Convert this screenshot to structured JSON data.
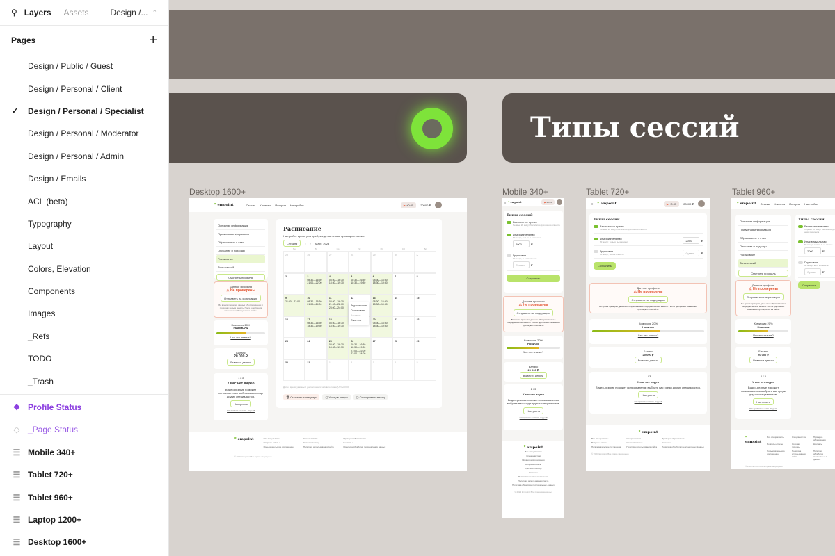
{
  "panel": {
    "tabs": {
      "layers": "Layers",
      "assets": "Assets",
      "page_selector": "Design /..."
    },
    "pages_title": "Pages",
    "pages": [
      "Design / Public / Guest",
      "Design / Personal / Client",
      "Design / Personal / Specialist",
      "Design / Personal / Moderator",
      "Design / Personal / Admin",
      "Design / Emails",
      "ACL (beta)",
      "Typography",
      "Layout",
      "Colors, Elevation",
      "Components",
      "Images",
      "_Refs",
      "TODO",
      "_Trash"
    ],
    "selected_page": "Design / Personal / Specialist",
    "layers": [
      {
        "label": "Profile Status",
        "type": "component"
      },
      {
        "label": "_Page Status",
        "type": "instance"
      },
      {
        "label": "Mobile 340+",
        "type": "frame"
      },
      {
        "label": "Tablet 720+",
        "type": "frame"
      },
      {
        "label": "Tablet 960+",
        "type": "frame"
      },
      {
        "label": "Laptop 1200+",
        "type": "frame"
      },
      {
        "label": "Desktop 1600+",
        "type": "frame"
      }
    ]
  },
  "canvas": {
    "cover_title": "Типы сессий",
    "accent": "#7ee33a",
    "frames": {
      "desktop": "Desktop 1600+",
      "mobile": "Mobile 340+",
      "tablet720": "Tablet 720+",
      "tablet960": "Tablet 960+"
    }
  },
  "site": {
    "logo": "empoint",
    "nav": [
      "Сессии",
      "Клиенты",
      "Истории",
      "Настройки"
    ],
    "timer": "+0:05",
    "balance_short": "20000 ₽",
    "menu": [
      "Основная информация",
      "Приватная информация",
      "Образование и стаж",
      "Описание и подходы",
      "Расписание",
      "Типы сессий"
    ],
    "view_profile": "Смотреть профиль",
    "profile_label": "Данные профиля",
    "profile_status": "Не проверены",
    "send_moderation": "Отправить на модерацию",
    "moderation_note": "Во время проверки данных об образовании и подходах нельзя менять. После одобрения изменения публикуются на сайте.",
    "commission": "Комиссия 20%",
    "level": "Новичок",
    "level_progress": 0.6,
    "what_means": "Что это значит?",
    "balance_label": "Баланс",
    "balance": "20 000 ₽",
    "withdraw": "Вывести деньги",
    "video_pager": "1 / 3",
    "no_video": "У вас нет видео",
    "video_text": "Видео-резюме поможет пользователям выбрать вас среди других специалистов.",
    "setup": "Настроить",
    "how_record": "Как правильно снять видео?",
    "footer_links": [
      "Все специалисты",
      "Специалистам",
      "Проверка образования",
      "Вопросы-ответы",
      "Срочная помощь",
      "Контакты",
      "Пользовательское соглашение",
      "Политика использования сайта",
      "Политика обработки персональных данных"
    ],
    "copyright": "© 2023 Empoint. Все права защищены."
  },
  "schedule": {
    "title": "Расписание",
    "subtitle": "Настройте время для дней, когда вы готовы проводить сессии.",
    "today": "Сегодня",
    "month": "Март, 2023",
    "weekdays": [
      "Пн",
      "Вт",
      "Ср",
      "Чт",
      "Пт",
      "Сб",
      "Вс"
    ],
    "cells": [
      [
        "25",
        [],
        1
      ],
      [
        "26",
        [],
        1
      ],
      [
        "27",
        [],
        1
      ],
      [
        "28",
        [],
        1
      ],
      [
        "29",
        [],
        1
      ],
      [
        "30",
        [],
        1
      ],
      [
        "1",
        [],
        0
      ],
      [
        "2",
        [],
        0
      ],
      [
        "3",
        [
          "08:30—16:30",
          "21:00—22:00"
        ],
        0
      ],
      [
        "4",
        [
          "08:30—16:30",
          "18:30—19:30"
        ],
        0
      ],
      [
        "5",
        [
          "08:30—16:30",
          "18:30—19:30"
        ],
        0
      ],
      [
        "6",
        [
          "08:30—16:30",
          "18:30—19:30"
        ],
        0
      ],
      [
        "7",
        [],
        0
      ],
      [
        "8",
        [],
        0
      ],
      [
        "9",
        [
          "21:00—22:00"
        ],
        0
      ],
      [
        "10",
        [
          "08:30—16:30",
          "21:00—24:00"
        ],
        0
      ],
      [
        "11",
        [
          "08:30—16:30",
          "21:00—22:00",
          "23:00—24:00"
        ],
        0
      ],
      [
        "12",
        [],
        0
      ],
      [
        "13",
        [
          "08:30—16:30",
          "18:30—19:30"
        ],
        0
      ],
      [
        "14",
        [],
        0
      ],
      [
        "15",
        [],
        0
      ],
      [
        "16",
        [],
        0
      ],
      [
        "17",
        [
          "08:30—16:30",
          "18:30—19:30"
        ],
        0
      ],
      [
        "18",
        [
          "08:30—16:30",
          "18:30—19:30"
        ],
        0
      ],
      [
        "19",
        [],
        0
      ],
      [
        "20",
        [
          "08:30—16:30",
          "18:30—19:30"
        ],
        0
      ],
      [
        "21",
        [],
        0
      ],
      [
        "22",
        [],
        0
      ],
      [
        "23",
        [],
        0
      ],
      [
        "24",
        [],
        0
      ],
      [
        "25",
        [
          "08:30—16:30",
          "18:30—19:30"
        ],
        0
      ],
      [
        "26",
        [
          "08:30—16:30",
          "18:30—19:30",
          "21:00—22:00",
          "23:00—24:00"
        ],
        0
      ],
      [
        "27",
        [],
        0
      ],
      [
        "28",
        [],
        0
      ],
      [
        "29",
        [],
        0
      ],
      [
        "30",
        [],
        0
      ],
      [
        "31",
        [],
        0
      ],
      [
        "1",
        [],
        1
      ],
      [
        "2",
        [],
        1
      ],
      [
        "3",
        [],
        1
      ],
      [
        "4",
        [],
        1
      ],
      [
        "5",
        [],
        1
      ]
    ],
    "context_menu": [
      "Редактировать",
      "Скопировать",
      "Вставить",
      "Очистить"
    ],
    "tz_note": "Дата и время указаны с учетом вашего часового пояса (UTC+03:00)",
    "actions": [
      "Очистить календарь",
      "Ухожу в отпуск",
      "Скопировать месяц"
    ]
  },
  "sessions": {
    "title": "Типы сессий",
    "types": [
      {
        "name": "Бесплатное время",
        "desc": "Первые 20 минут бесплатно для нового клиента",
        "on": true,
        "price": ""
      },
      {
        "name": "Индивидуальная",
        "desc": "60 минут, только вы и клиент",
        "on": true,
        "price": "2000"
      },
      {
        "name": "Групповая",
        "desc": "90 минут, вы и 2 клиента",
        "on": false,
        "price": ""
      }
    ],
    "price_placeholder": "Сумма",
    "currency": "₽",
    "save": "Сохранить"
  }
}
